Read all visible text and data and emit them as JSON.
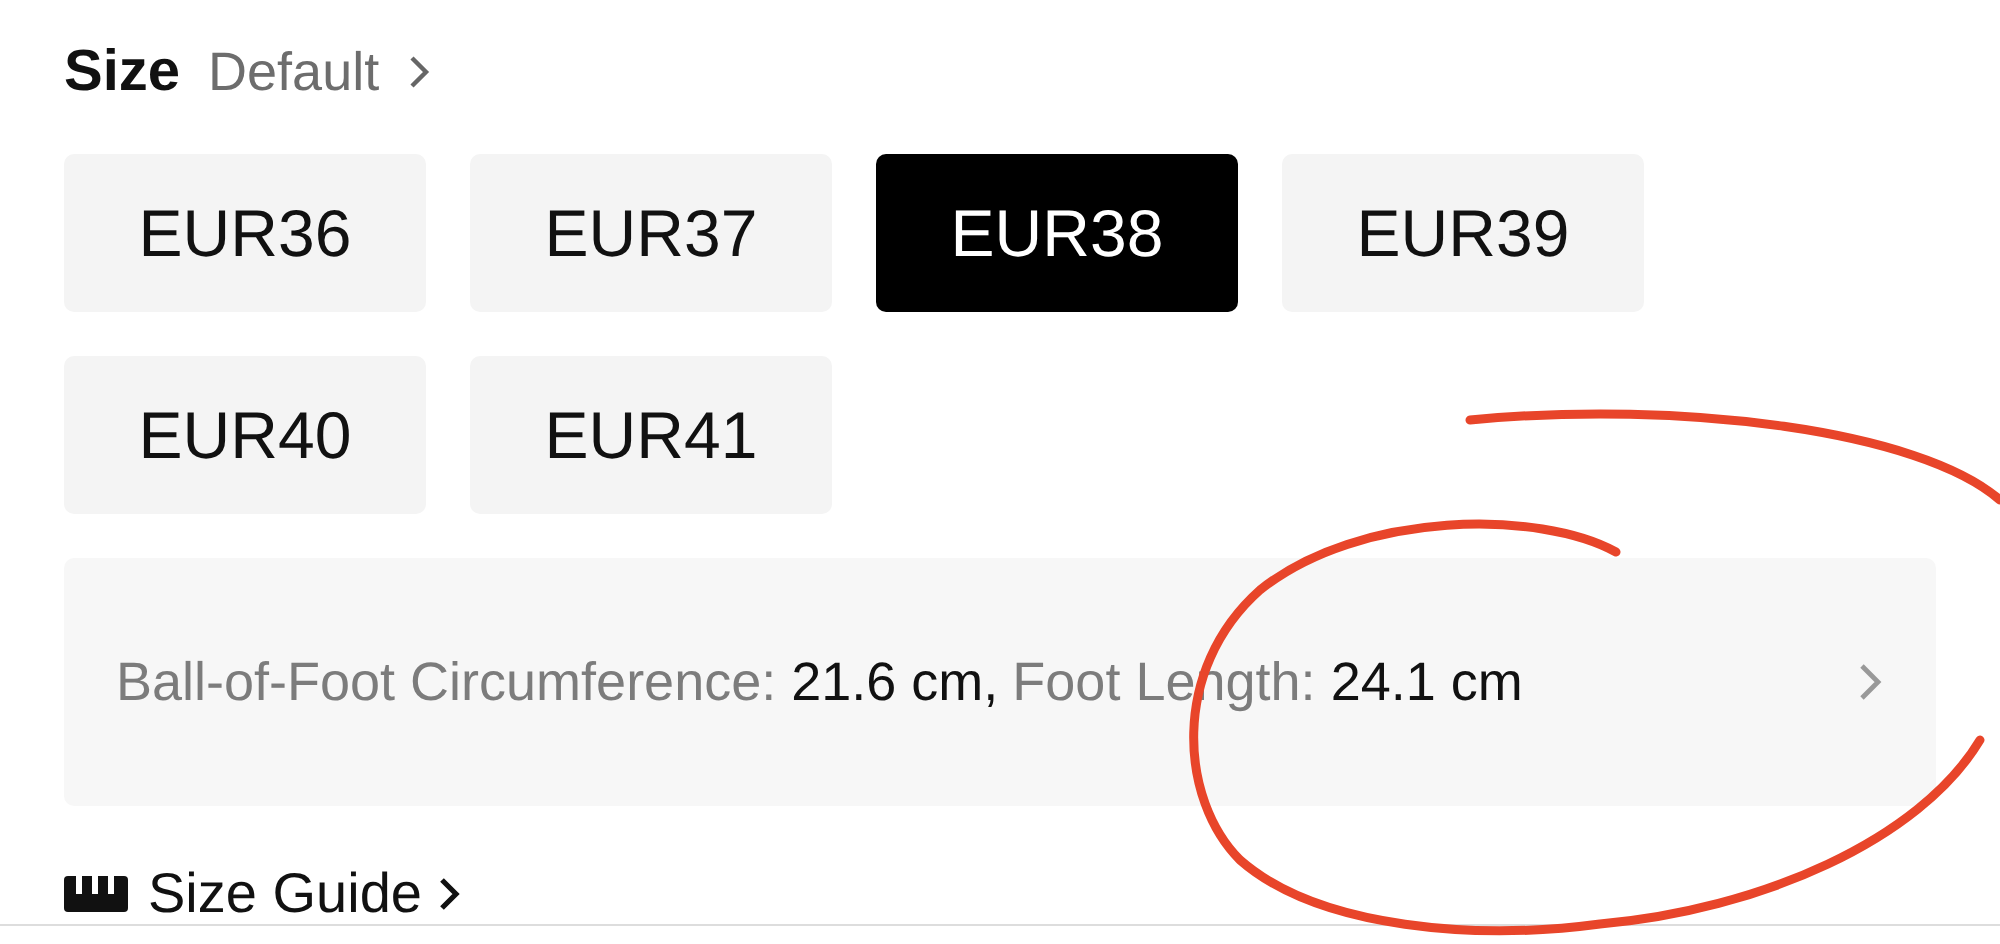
{
  "header": {
    "title": "Size",
    "value": "Default"
  },
  "sizes": [
    {
      "label": "EUR36",
      "selected": false
    },
    {
      "label": "EUR37",
      "selected": false
    },
    {
      "label": "EUR38",
      "selected": true
    },
    {
      "label": "EUR39",
      "selected": false
    },
    {
      "label": "EUR40",
      "selected": false
    },
    {
      "label": "EUR41",
      "selected": false
    }
  ],
  "measurements": [
    {
      "label": "Ball-of-Foot Circumference:",
      "value": "21.6 cm,"
    },
    {
      "label": "Foot Length:",
      "value": "24.1 cm"
    }
  ],
  "size_guide": {
    "label": "Size Guide"
  }
}
